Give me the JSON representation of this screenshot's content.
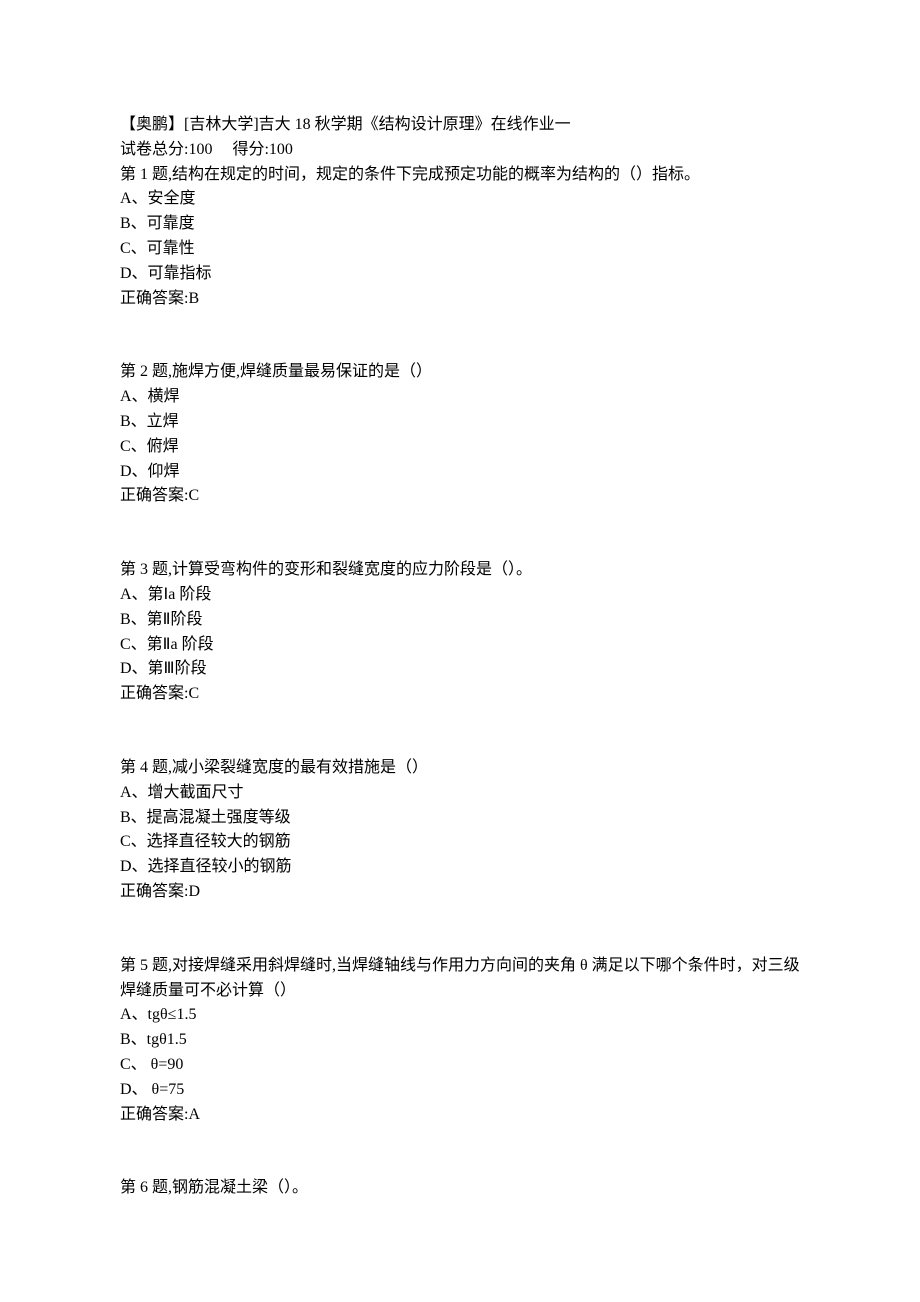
{
  "header": {
    "title": "【奥鹏】[吉林大学]吉大 18 秋学期《结构设计原理》在线作业一",
    "total_label": "试卷总分:100",
    "score_label": "得分:100"
  },
  "questions": [
    {
      "stem": "第 1 题,结构在规定的时间，规定的条件下完成预定功能的概率为结构的（）指标。",
      "options": [
        "A、安全度",
        "B、可靠度",
        "C、可靠性",
        "D、可靠指标"
      ],
      "answer": "正确答案:B"
    },
    {
      "stem": "第 2 题,施焊方便,焊缝质量最易保证的是（）",
      "options": [
        "A、横焊",
        "B、立焊",
        "C、俯焊",
        "D、仰焊"
      ],
      "answer": "正确答案:C"
    },
    {
      "stem": "第 3 题,计算受弯构件的变形和裂缝宽度的应力阶段是（）。",
      "options": [
        "A、第Ⅰa 阶段",
        "B、第Ⅱ阶段",
        "C、第Ⅱa 阶段",
        "D、第Ⅲ阶段"
      ],
      "answer": "正确答案:C"
    },
    {
      "stem": "第 4 题,减小梁裂缝宽度的最有效措施是（）",
      "options": [
        "A、增大截面尺寸",
        "B、提高混凝土强度等级",
        "C、选择直径较大的钢筋",
        "D、选择直径较小的钢筋"
      ],
      "answer": "正确答案:D"
    },
    {
      "stem": "第 5 题,对接焊缝采用斜焊缝时,当焊缝轴线与作用力方向间的夹角 θ 满足以下哪个条件时，对三级焊缝质量可不必计算（）",
      "options": [
        "A、tgθ≤1.5",
        "B、tgθ1.5",
        "C、 θ=90",
        "D、 θ=75"
      ],
      "answer": "正确答案:A"
    },
    {
      "stem": "第 6 题,钢筋混凝土梁（）。",
      "options": [],
      "answer": ""
    }
  ]
}
